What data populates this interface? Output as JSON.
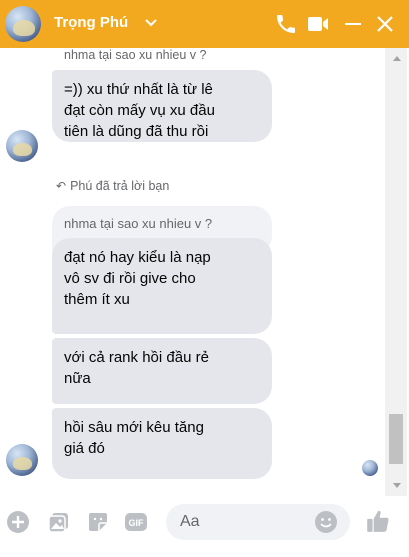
{
  "header": {
    "contact_name": "Trọng Phú",
    "background_color": "#f3a91f",
    "icons": [
      "chevron-down-icon",
      "phone-icon",
      "video-camera-icon",
      "minimize-icon",
      "close-icon"
    ]
  },
  "messages": {
    "top_reply_preview": "nhma tại sao xu nhieu v ?",
    "bubble1": [
      "=)) xu thứ nhất là từ lê",
      "đạt còn mấy vụ xu đầu",
      "tiên là dũng đã thu rồi"
    ],
    "replied_notice": "Phú đã trả lời bạn",
    "quoted_text": "nhma tại sao xu nhieu v ?",
    "bubble2": [
      "đạt nó hay kiểu là nạp",
      "vô sv đi rồi give cho",
      "thêm ít xu"
    ],
    "bubble3": [
      "với cả rank hồi đầu rẻ",
      "nữa"
    ],
    "bubble4": [
      "hồi sâu mới kêu tăng",
      "giá đó"
    ]
  },
  "composer": {
    "placeholder": "Aa",
    "accent_color": "#bcc0c4",
    "icons": [
      "plus-icon",
      "photo-icon",
      "sticker-icon",
      "gif-icon",
      "emoji-icon",
      "thumbs-up-icon"
    ]
  }
}
